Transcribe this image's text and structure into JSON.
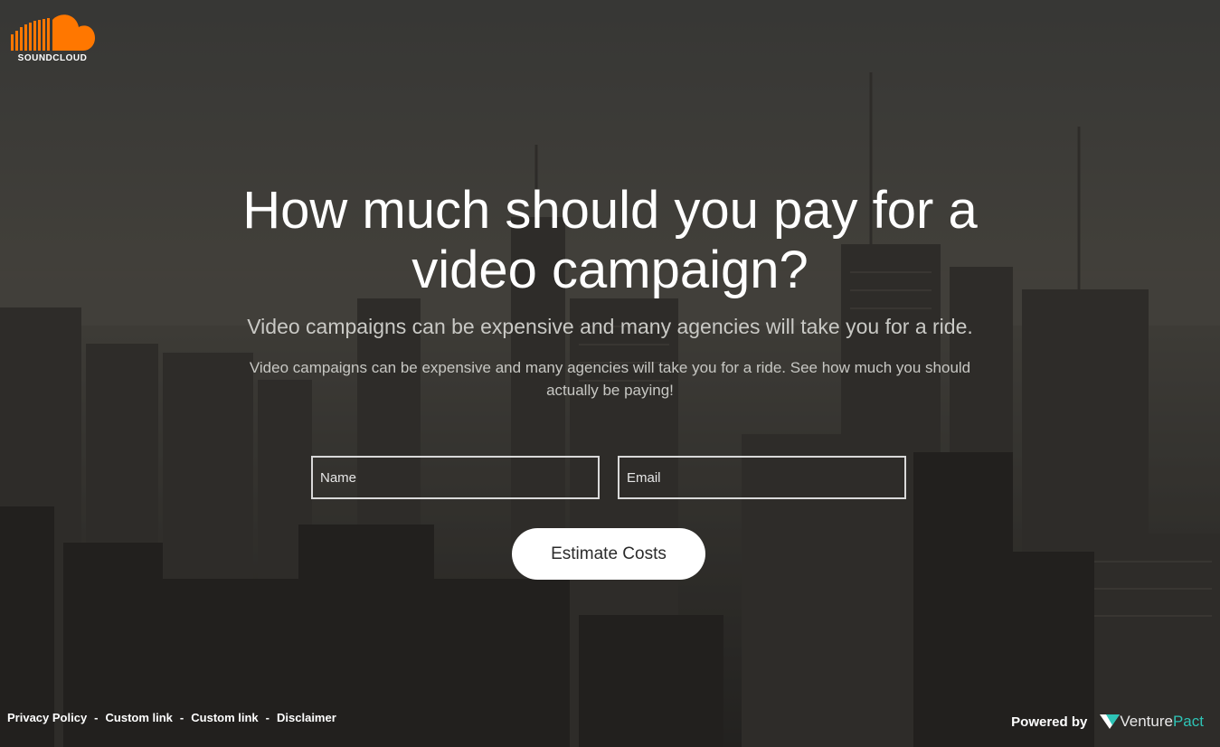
{
  "brand": {
    "logo_text": "SOUNDCLOUD",
    "logo_color": "#ff7700"
  },
  "hero": {
    "headline": "How much should you pay for a video campaign?",
    "subheadline": "Video campaigns can be expensive and many agencies will take you for a ride.",
    "description": "Video campaigns can be expensive and many agencies will take you for a ride. See how much you should actually be paying!"
  },
  "form": {
    "name_placeholder": "Name",
    "email_placeholder": "Email",
    "submit_label": "Estimate Costs"
  },
  "footer": {
    "links": [
      {
        "label": "Privacy Policy"
      },
      {
        "label": "Custom link"
      },
      {
        "label": "Custom link"
      },
      {
        "label": "Disclaimer"
      }
    ],
    "separator": "-",
    "powered_by": "Powered by",
    "vendor_name_part1": "Venture",
    "vendor_name_part2": "Pact",
    "vendor_accent_color": "#2ec4b6"
  }
}
